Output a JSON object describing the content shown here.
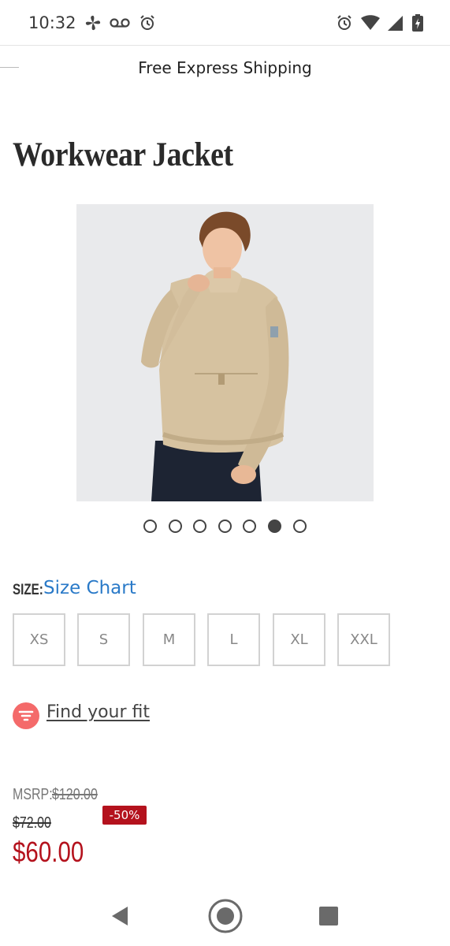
{
  "status_bar": {
    "time": "10:32",
    "left_icons": [
      "fan-icon",
      "voicemail-icon",
      "alarm-icon"
    ],
    "right_icons": [
      "alarm-icon",
      "wifi-icon",
      "cell-signal-icon",
      "battery-charging-icon"
    ]
  },
  "promo": {
    "text": "Free Express Shipping"
  },
  "product": {
    "title": "Workwear Jacket",
    "image_alt": "Man wearing beige workwear jacket",
    "carousel": {
      "count": 7,
      "active_index": 5
    }
  },
  "size": {
    "label": "SIZE:",
    "chart_link": "Size Chart",
    "options": [
      "XS",
      "S",
      "M",
      "L",
      "XL",
      "XXL"
    ]
  },
  "fit": {
    "label": "Find your fit"
  },
  "pricing": {
    "msrp_label": "MSRP:",
    "msrp_value": "$120.00",
    "compare_price": "$72.00",
    "discount_badge": "-50%",
    "sale_price": "$60.00"
  },
  "colors": {
    "accent_red": "#b4121d",
    "link_blue": "#2a7ac8",
    "fit_icon": "#f46a6a"
  },
  "nav_bar": {
    "buttons": [
      "back-icon",
      "home-icon",
      "recents-icon"
    ]
  }
}
